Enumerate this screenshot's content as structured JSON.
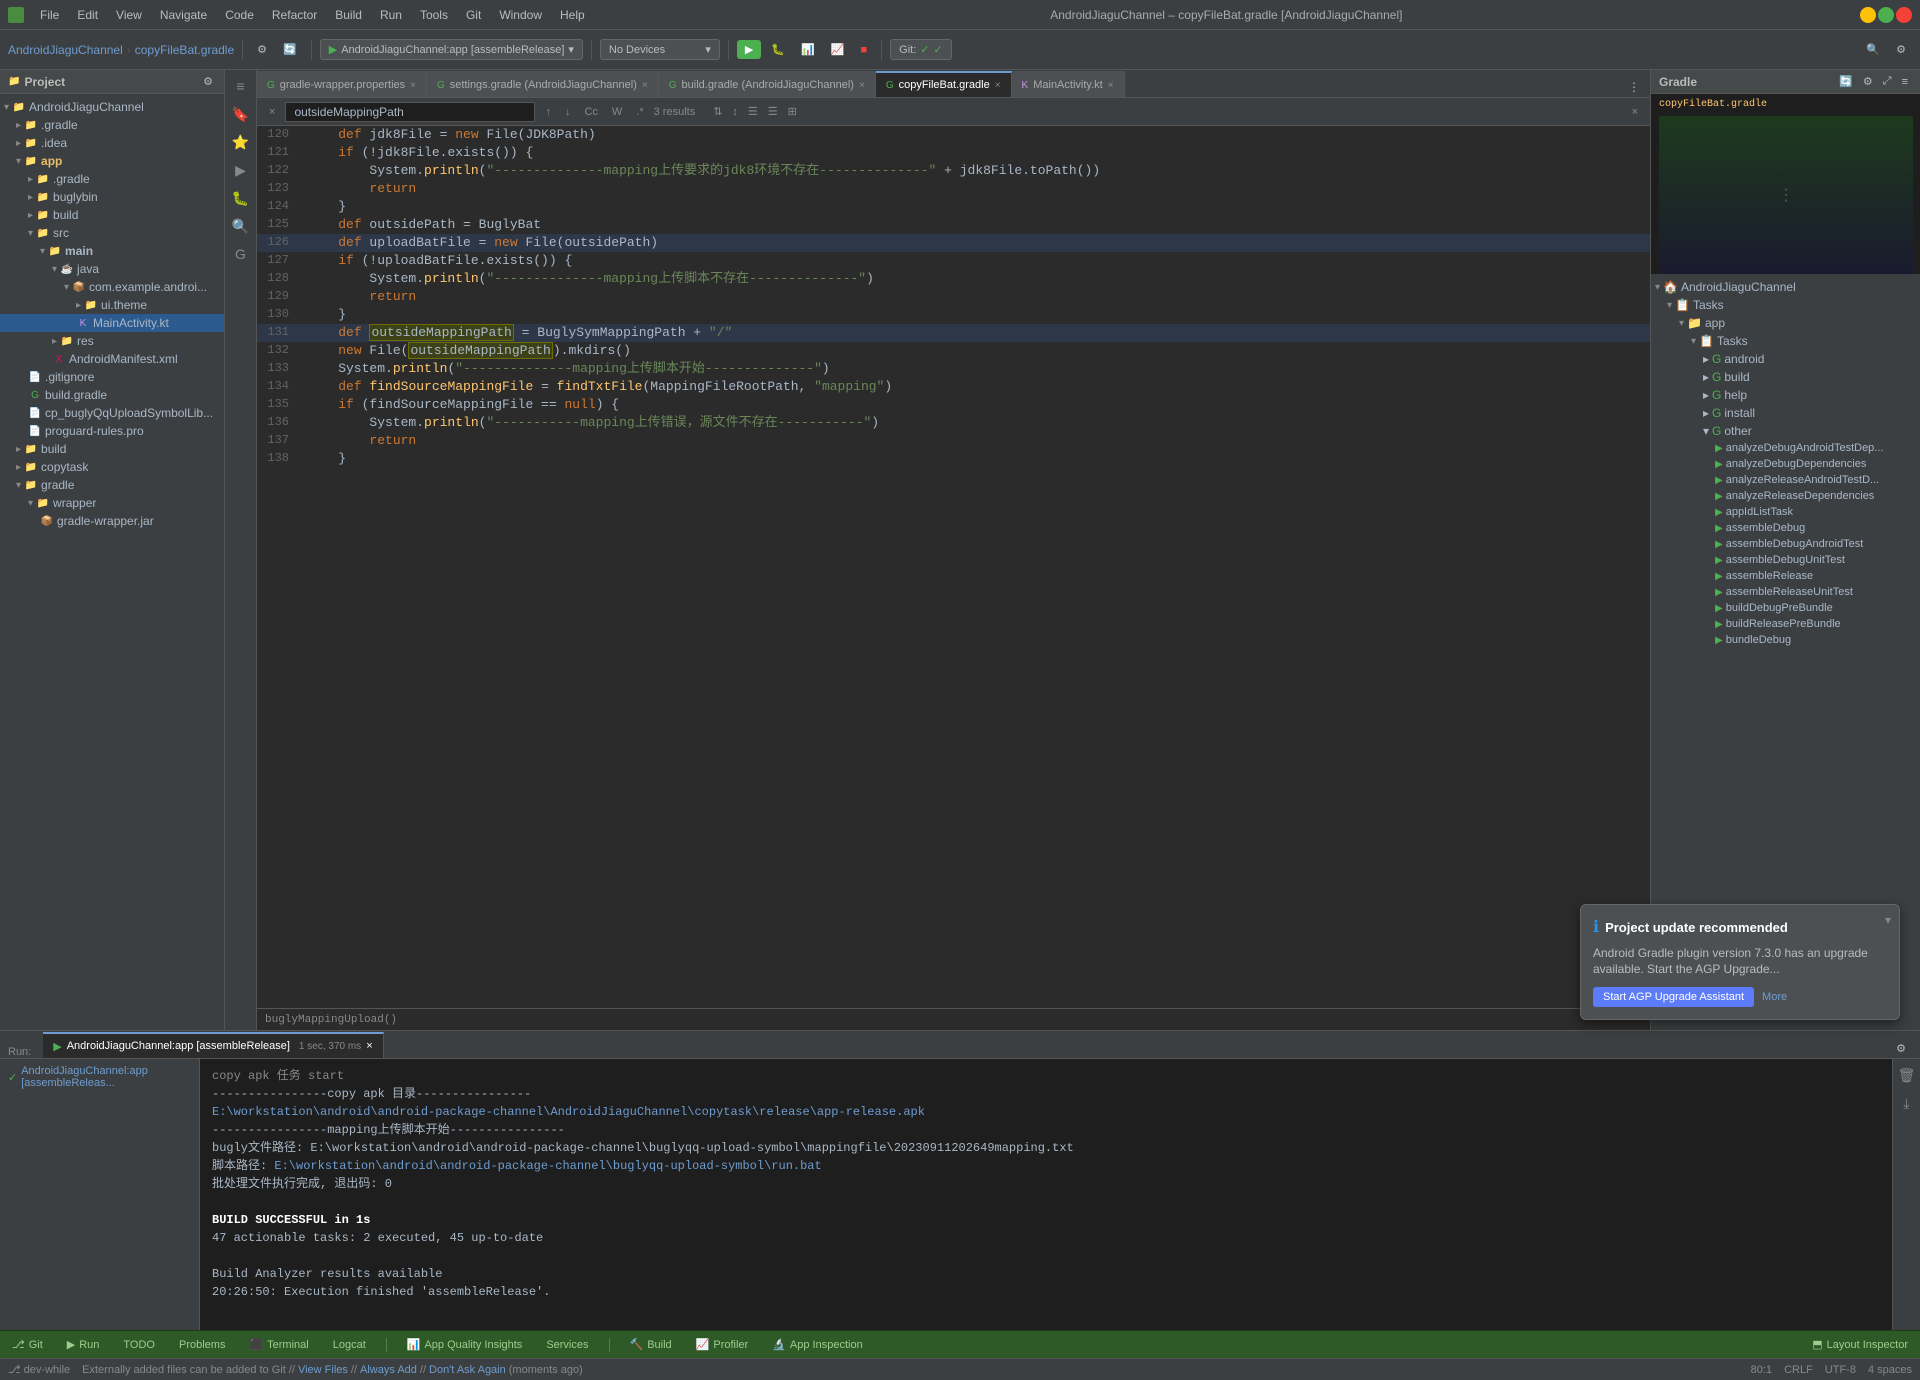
{
  "app": {
    "title": "AndroidJiaguChannel – copyFileBat.gradle [AndroidJiaguChannel]"
  },
  "menu": {
    "items": [
      "File",
      "Edit",
      "View",
      "Navigate",
      "Code",
      "Refactor",
      "Build",
      "Run",
      "Tools",
      "Git",
      "Window",
      "Help"
    ]
  },
  "toolbar": {
    "breadcrumb": {
      "project": "AndroidJiaguChannel",
      "separator": "›",
      "file": "copyFileBat.gradle"
    },
    "run_config": "AndroidJiaguChannel:app [assembleRelease]",
    "device": "No Devices",
    "git": "Git:"
  },
  "tabs": [
    {
      "id": "gradle-wrapper",
      "label": "gradle-wrapper.properties",
      "active": false
    },
    {
      "id": "settings-gradle",
      "label": "settings.gradle (AndroidJiaguChannel)",
      "active": false
    },
    {
      "id": "build-gradle",
      "label": "build.gradle (AndroidJiaguChannel)",
      "active": false
    },
    {
      "id": "copyfilebat",
      "label": "copyFileBat.gradle",
      "active": true
    },
    {
      "id": "mainactivity",
      "label": "MainActivity.kt",
      "active": false
    }
  ],
  "search": {
    "query": "outsideMappingPath",
    "results": "3 results",
    "placeholder": "outsideMappingPath"
  },
  "code": {
    "lines": [
      {
        "num": 120,
        "content": "    def jdk8File = new File(JDK8Path)"
      },
      {
        "num": 121,
        "content": "    if (!jdk8File.exists()) {"
      },
      {
        "num": 122,
        "content": "        System.println(\"--------------mapping上传要求的jdk8环境不存在--------------\" + jdk8File.toPath())"
      },
      {
        "num": 123,
        "content": "        return"
      },
      {
        "num": 124,
        "content": "    }"
      },
      {
        "num": 125,
        "content": "    def outsidePath = BuglyBat"
      },
      {
        "num": 126,
        "content": "    def uploadBatFile = new File(outsidePath)"
      },
      {
        "num": 127,
        "content": "    if (!uploadBatFile.exists()) {"
      },
      {
        "num": 128,
        "content": "        System.println(\"--------------mapping上传脚本不存在--------------\")"
      },
      {
        "num": 129,
        "content": "        return"
      },
      {
        "num": 130,
        "content": "    }"
      },
      {
        "num": 131,
        "content": "    def outsideMappingPath = BuglySymMappingPath + \"/\""
      },
      {
        "num": 132,
        "content": "    new File(outsideMappingPath).mkdirs()"
      },
      {
        "num": 133,
        "content": "    System.println(\"--------------mapping上传脚本开始--------------\")"
      },
      {
        "num": 134,
        "content": "    def findSourceMappingFile = findTxtFile(MappingFileRootPath, \"mapping\")"
      },
      {
        "num": 135,
        "content": "    if (findSourceMappingFile == null) {"
      },
      {
        "num": 136,
        "content": "        System.println(\"-----------mapping上传错误，源文件不存在-----------\")"
      },
      {
        "num": 137,
        "content": "        return"
      },
      {
        "num": 138,
        "content": "    }"
      }
    ]
  },
  "project_tree": {
    "title": "Project",
    "root": "AndroidJiaguChannel",
    "items": [
      {
        "indent": 1,
        "label": ".gradle",
        "icon": "folder",
        "expanded": false
      },
      {
        "indent": 1,
        "label": ".idea",
        "icon": "folder",
        "expanded": false
      },
      {
        "indent": 1,
        "label": "app",
        "icon": "folder",
        "expanded": true
      },
      {
        "indent": 2,
        "label": ".gradle",
        "icon": "folder",
        "expanded": false
      },
      {
        "indent": 2,
        "label": "buglybin",
        "icon": "folder",
        "expanded": false
      },
      {
        "indent": 2,
        "label": "build",
        "icon": "folder",
        "expanded": false
      },
      {
        "indent": 2,
        "label": "src",
        "icon": "folder",
        "expanded": true
      },
      {
        "indent": 3,
        "label": "main",
        "icon": "folder",
        "expanded": true
      },
      {
        "indent": 4,
        "label": "java",
        "icon": "folder",
        "expanded": true
      },
      {
        "indent": 5,
        "label": "com.example.androi...",
        "icon": "folder",
        "expanded": true
      },
      {
        "indent": 5,
        "label": "ui.theme",
        "icon": "folder",
        "expanded": false
      },
      {
        "indent": 5,
        "label": "MainActivity.kt",
        "icon": "kotlin",
        "expanded": false
      },
      {
        "indent": 4,
        "label": "res",
        "icon": "folder",
        "expanded": false
      },
      {
        "indent": 4,
        "label": "AndroidManifest.xml",
        "icon": "xml",
        "expanded": false
      },
      {
        "indent": 2,
        "label": ".gitignore",
        "icon": "file",
        "expanded": false
      },
      {
        "indent": 2,
        "label": "build.gradle",
        "icon": "gradle",
        "expanded": false
      },
      {
        "indent": 2,
        "label": "cp_buglyQqUploadSymbolLib...",
        "icon": "file",
        "expanded": false
      },
      {
        "indent": 2,
        "label": "proguard-rules.pro",
        "icon": "file",
        "expanded": false
      },
      {
        "indent": 1,
        "label": "build",
        "icon": "folder",
        "expanded": false
      },
      {
        "indent": 1,
        "label": "copytask",
        "icon": "folder",
        "expanded": false
      },
      {
        "indent": 1,
        "label": "gradle",
        "icon": "folder",
        "expanded": true
      },
      {
        "indent": 2,
        "label": "wrapper",
        "icon": "folder",
        "expanded": true
      },
      {
        "indent": 3,
        "label": "gradle-wrapper.jar",
        "icon": "file",
        "expanded": false
      }
    ]
  },
  "gradle_panel": {
    "title": "Gradle",
    "root": "AndroidJiaguChannel",
    "items": [
      {
        "indent": 0,
        "label": "AndroidJiaguChannel",
        "icon": "folder"
      },
      {
        "indent": 1,
        "label": "Tasks",
        "icon": "folder"
      },
      {
        "indent": 2,
        "label": "app",
        "icon": "folder"
      },
      {
        "indent": 3,
        "label": "Tasks",
        "icon": "folder"
      },
      {
        "indent": 4,
        "label": "android",
        "icon": "gradle"
      },
      {
        "indent": 4,
        "label": "build",
        "icon": "gradle"
      },
      {
        "indent": 4,
        "label": "help",
        "icon": "gradle"
      },
      {
        "indent": 4,
        "label": "install",
        "icon": "gradle"
      },
      {
        "indent": 4,
        "label": "other",
        "icon": "gradle"
      },
      {
        "indent": 5,
        "label": "analyzeDebugAndroidTestDependencies",
        "icon": "task"
      },
      {
        "indent": 5,
        "label": "analyzeDebugDependencies",
        "icon": "task"
      },
      {
        "indent": 5,
        "label": "analyzeReleaseAndroidTestDepend...",
        "icon": "task"
      },
      {
        "indent": 5,
        "label": "analyzeReleaseDependencies",
        "icon": "task"
      },
      {
        "indent": 5,
        "label": "appIdListTask",
        "icon": "task"
      },
      {
        "indent": 5,
        "label": "assembleDebug",
        "icon": "task"
      },
      {
        "indent": 5,
        "label": "assembleDebugAndroidTest",
        "icon": "task"
      },
      {
        "indent": 5,
        "label": "assembleDebugUnitTest",
        "icon": "task"
      },
      {
        "indent": 5,
        "label": "assembleRelease",
        "icon": "task"
      },
      {
        "indent": 5,
        "label": "assembleReleaseUnitTest",
        "icon": "task"
      },
      {
        "indent": 5,
        "label": "buildDebugPreBundle",
        "icon": "task"
      },
      {
        "indent": 5,
        "label": "buildReleasePreBundle",
        "icon": "task"
      },
      {
        "indent": 5,
        "label": "bundleDebug",
        "icon": "task"
      }
    ]
  },
  "run_panel": {
    "title": "Run:",
    "active_config": "AndroidJiaguChannel:app [assembleRelease]",
    "timing": "1 sec, 370 ms",
    "left_items": [
      {
        "label": "AndroidJiaguChannel:app [assembleReleas...",
        "status": "success"
      }
    ],
    "output": [
      {
        "type": "text",
        "content": "    copy apk 任务 start"
      },
      {
        "type": "text",
        "content": "----------------copy apk 目录----------------"
      },
      {
        "type": "link",
        "content": "E:\\workstation\\android\\android-package-channel\\AndroidJiaguChannel\\copytask\\release\\app-release.apk"
      },
      {
        "type": "text",
        "content": "----------------mapping上传脚本开始----------------"
      },
      {
        "type": "text",
        "content": "bugly文件路径: E:\\workstation\\android\\android-package-channel\\buglyqq-upload-symbol\\mappingfile\\20230911202649mapping.txt"
      },
      {
        "type": "text",
        "content": "脚本路径:",
        "link": "E:\\workstation\\android\\android-package-channel\\buglyqq-upload-symbol\\run.bat"
      },
      {
        "type": "text",
        "content": "批处理文件执行完成, 退出码: 0"
      },
      {
        "type": "blank"
      },
      {
        "type": "bold",
        "content": "BUILD SUCCESSFUL in 1s"
      },
      {
        "type": "text",
        "content": "47 actionable tasks: 2 executed, 45 up-to-date"
      },
      {
        "type": "blank"
      },
      {
        "type": "text",
        "content": "Build Analyzer results available"
      },
      {
        "type": "text",
        "content": "20:26:50: Execution finished 'assembleRelease'."
      }
    ]
  },
  "notification": {
    "title": "Project update recommended",
    "text": "Android Gradle plugin version 7.3.0 has an upgrade available. Start the AGP Upgrade...",
    "btn_label": "Start AGP Upgrade Assistant",
    "more_label": "More"
  },
  "bottom_toolbar": {
    "items": [
      {
        "id": "git",
        "label": "Git"
      },
      {
        "id": "run",
        "label": "Run"
      },
      {
        "id": "todo",
        "label": "TODO"
      },
      {
        "id": "problems",
        "label": "Problems"
      },
      {
        "id": "terminal",
        "label": "Terminal"
      },
      {
        "id": "logcat",
        "label": "Logcat"
      },
      {
        "id": "app-quality",
        "label": "App Quality Insights"
      },
      {
        "id": "services",
        "label": "Services"
      },
      {
        "id": "build",
        "label": "Build"
      },
      {
        "id": "profiler",
        "label": "Profiler"
      },
      {
        "id": "app-inspection",
        "label": "App Inspection"
      }
    ],
    "right_items": [
      {
        "id": "layout-inspector",
        "label": "Layout Inspector"
      }
    ]
  },
  "status_bar": {
    "position": "80:1",
    "encoding": "CRLF",
    "charset": "UTF-8",
    "indent": "4 spaces",
    "branch": "dev-while"
  },
  "info_bar": {
    "message": "Externally added files can be added to Git // View Files // Always Add // Don't Ask Again (moments ago)"
  }
}
